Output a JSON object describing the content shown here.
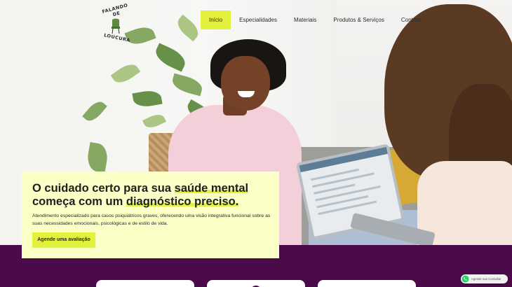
{
  "brand": {
    "logo_top": "FALANDO DE",
    "logo_bottom": "LOUCURA"
  },
  "nav": {
    "items": [
      {
        "label": "Início",
        "active": true
      },
      {
        "label": "Especialidades",
        "active": false
      },
      {
        "label": "Materiais",
        "active": false
      },
      {
        "label": "Produtos & Serviços",
        "active": false
      },
      {
        "label": "Contato",
        "active": false
      }
    ]
  },
  "hero": {
    "title_part1": "O cuidado certo para sua ",
    "title_highlight1": "saúde mental",
    "title_part2": " começa com um ",
    "title_highlight2": "diagnóstico preciso.",
    "description": "Atendimento especializado para casos psiquiátricos graves, oferecendo uma visão integrativa funcional sobre as suas necessidades emocionais, psicológicas e de estilo de vida.",
    "cta_label": "Agende uma avaliação"
  },
  "whatsapp": {
    "label": "Agende sua Consulta!",
    "icon": "whatsapp-icon"
  },
  "colors": {
    "accent": "#e3f03c",
    "card_bg": "#f9ffc5",
    "band": "#4b0b4a"
  }
}
